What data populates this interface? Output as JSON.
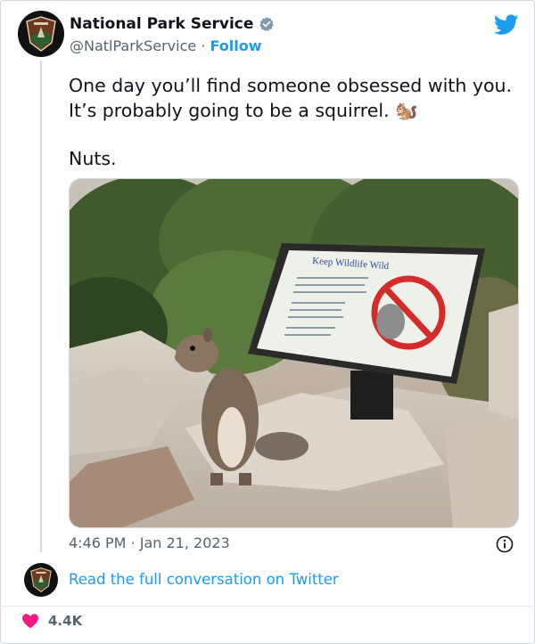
{
  "author": {
    "name": "National Park Service",
    "handle": "@NatlParkService",
    "separator": "·",
    "follow_label": "Follow",
    "verified": true,
    "avatar_icon": "nps-arrowhead-logo"
  },
  "tweet": {
    "line1": "One day you’ll find someone obsessed with you. It’s probably going to be a squirrel. 🐿️",
    "line2": "Nuts.",
    "photo": {
      "description_icon": "squirrel-photo",
      "sign_title": "Keep Wildlife Wild"
    },
    "time": "4:46 PM",
    "date": "Jan 21, 2023",
    "separator": "·"
  },
  "footer": {
    "read_link": "Read the full conversation on Twitter",
    "likes": "4.4K"
  },
  "colors": {
    "accent": "#1d9bf0",
    "text": "#0f1419",
    "muted": "#536471",
    "heart": "#f91880"
  }
}
